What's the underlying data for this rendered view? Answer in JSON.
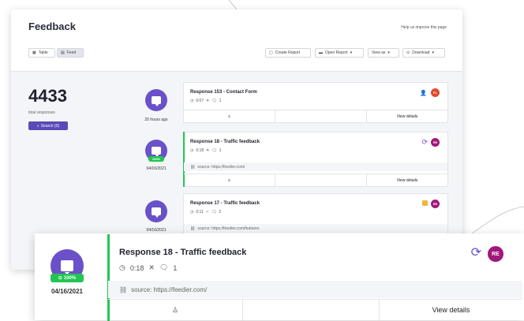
{
  "header": {
    "title": "Feedback",
    "help_link": "Help us improve this page"
  },
  "toolbar": {
    "view_table": "Table",
    "view_feed": "Feed",
    "create_report": "Create Report",
    "open_report": "Open Report",
    "view_as": "View as",
    "download": "Download"
  },
  "stats": {
    "total": "4433",
    "total_label": "total responses",
    "search_label": "Search (0)"
  },
  "responses": [
    {
      "time": "20 hours ago",
      "title": "Response 153 - Contact Form",
      "duration": "0:07",
      "comments": "1",
      "badge": "FL",
      "badge_color": "#e04a2f",
      "action": "View details"
    },
    {
      "date": "04/16/2021",
      "completion": "100%",
      "title": "Response 18 - Traffic feedback",
      "duration": "0:18",
      "comments": "1",
      "source": "source: https://feedier.com/",
      "badge": "RE",
      "badge_color": "#a0197a",
      "action": "View details"
    },
    {
      "date": "04/16/2021",
      "title": "Response 17 - Traffic feedback",
      "duration": "0:11",
      "comments": "2",
      "source": "source: https://feedier.com/features",
      "badge": "RE",
      "badge_color": "#a0197a"
    }
  ],
  "zoom": {
    "date": "04/16/2021",
    "completion": "100%",
    "title": "Response 18 - Traffic feedback",
    "duration": "0:18",
    "comments": "1",
    "source": "source: https://feedier.com/",
    "badge": "RE",
    "action": "View details"
  },
  "colors": {
    "accent": "#6a51c9",
    "success": "#23c552",
    "badge_fl": "#e04a2f",
    "badge_re": "#a0197a"
  }
}
